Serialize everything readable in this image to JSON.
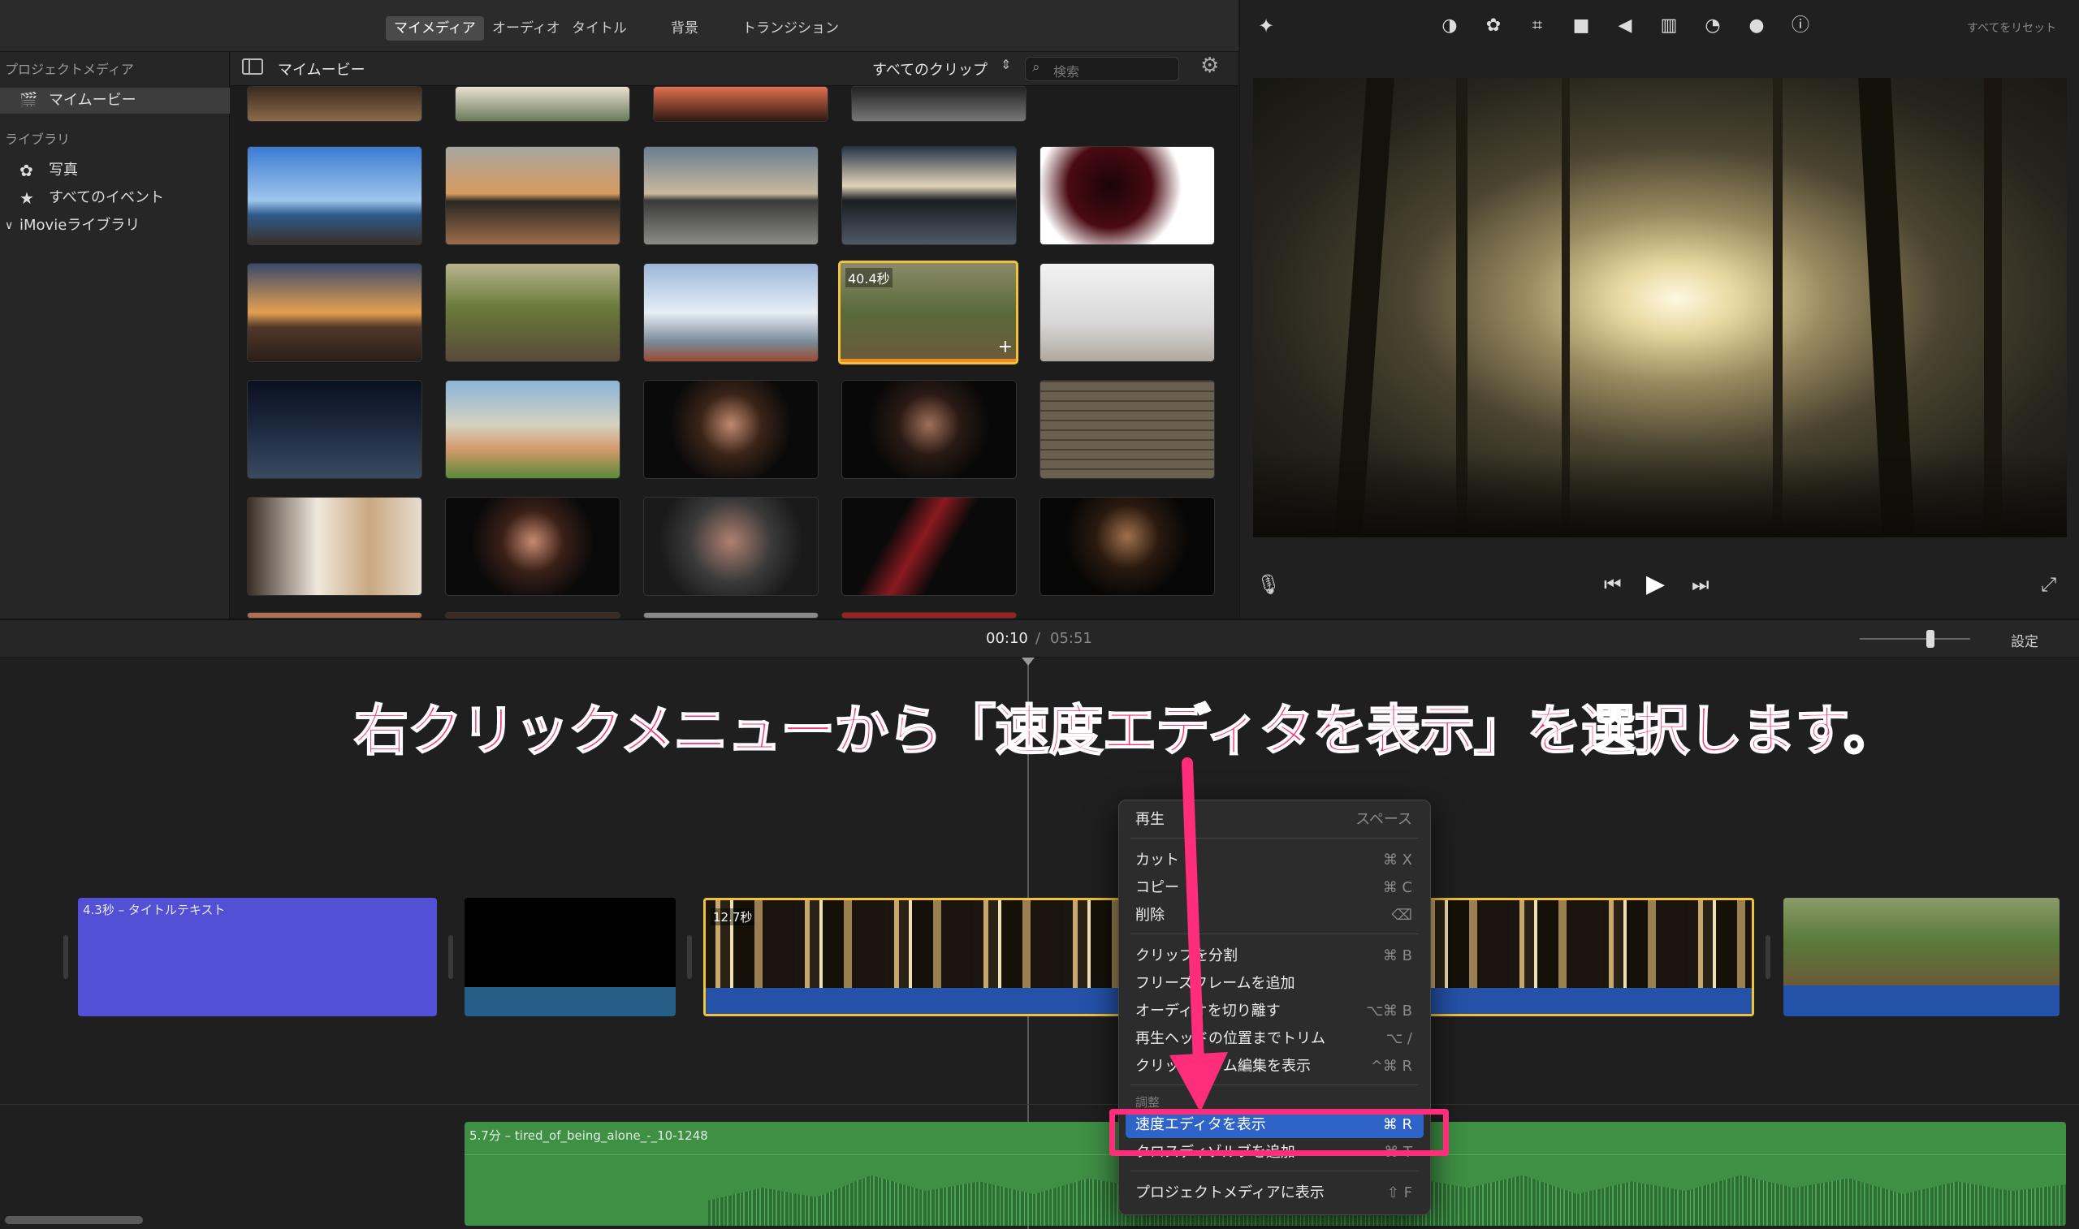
{
  "top_tabs": [
    {
      "label": "マイメディア"
    },
    {
      "label": "オーディオ"
    },
    {
      "label": "タイトル"
    },
    {
      "label": "背景"
    },
    {
      "label": "トランジション"
    }
  ],
  "sidebar": {
    "project_media_header": "プロジェクトメディア",
    "project_item": "マイムービー",
    "library_header": "ライブラリ",
    "items": [
      {
        "label": "写真"
      },
      {
        "label": "すべてのイベント"
      },
      {
        "label": "iMovieライブラリ"
      }
    ]
  },
  "browser": {
    "title": "マイムービー",
    "filter": "すべてのクリップ",
    "search_placeholder": "検索",
    "selected_clip_duration": "40.4秒"
  },
  "viewer": {
    "reset_all": "すべてをリセット"
  },
  "timeline": {
    "current_time": "00:10",
    "separator": "/",
    "total_time": "05:51",
    "settings": "設定",
    "title_clip_label": "4.3秒 – タイトルテキスト",
    "video_clip_label": "12.7秒",
    "audio_clip_label": "5.7分 – tired_of_being_alone_-_10-1248"
  },
  "annotation": {
    "text": "右クリックメニューから「速度エディタを表示」を選択します。",
    "color": "#ff2d7a"
  },
  "context_menu": {
    "items": [
      {
        "label": "再生",
        "shortcut": "スペース"
      },
      {
        "label": "カット",
        "shortcut": "⌘ X"
      },
      {
        "label": "コピー",
        "shortcut": "⌘ C"
      },
      {
        "label": "削除",
        "shortcut": "⌫"
      },
      {
        "label": "クリップを分割",
        "shortcut": "⌘ B"
      },
      {
        "label": "フリーズフレームを追加",
        "shortcut": ""
      },
      {
        "label": "オーディオを切り離す",
        "shortcut": "⌥⌘ B"
      },
      {
        "label": "再生ヘッドの位置までトリム",
        "shortcut": "⌥ /"
      },
      {
        "label": "クリップトリム編集を表示",
        "shortcut": "^⌘ R"
      },
      {
        "label": "調整",
        "shortcut": ""
      },
      {
        "label": "速度エディタを表示",
        "shortcut": "⌘ R"
      },
      {
        "label": "クロスディゾルブを追加",
        "shortcut": "⌘ T"
      },
      {
        "label": "プロジェクトメディアに表示",
        "shortcut": "⇧ F"
      }
    ]
  },
  "colors": {
    "accent": "#2e63c8",
    "annotation": "#ff2d7a",
    "title_clip": "#5250d4",
    "audio_clip": "#3f8f45",
    "selection": "#f2c33a"
  }
}
